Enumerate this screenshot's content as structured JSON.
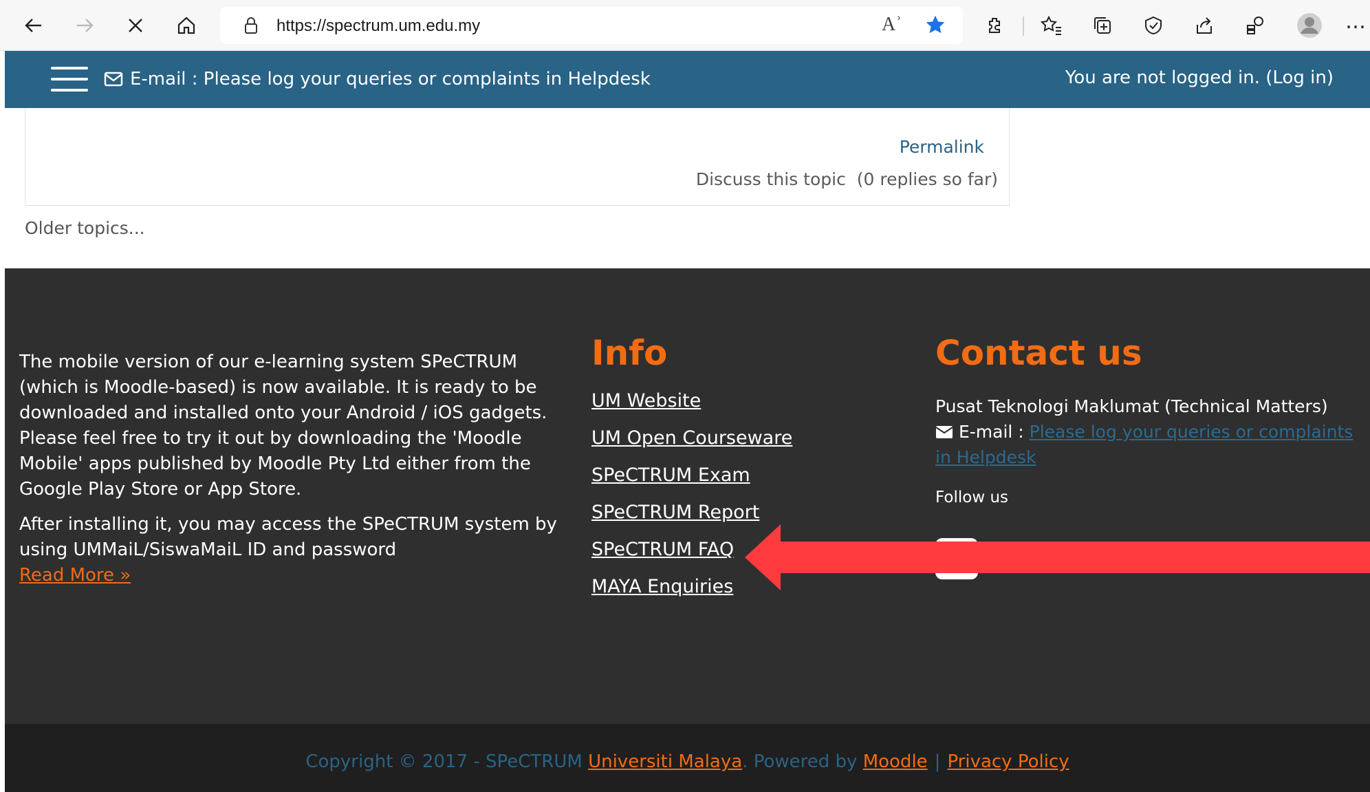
{
  "browser": {
    "url": "https://spectrum.um.edu.my",
    "icons": [
      "back-icon",
      "forward-icon",
      "stop-icon",
      "home-icon",
      "lock-icon",
      "read-aloud-icon",
      "favorite-star-icon",
      "extensions-icon",
      "favorites-icon",
      "collections-icon",
      "browser-essentials-icon",
      "share-icon",
      "performance-icon",
      "profile-icon",
      "more-icon"
    ],
    "read_aloud_glyph": "Aʾ",
    "more_glyph": "…"
  },
  "header": {
    "message": "E-mail : Please log your queries or complaints in Helpdesk",
    "login_status": "You are not logged in. (Log in)"
  },
  "post": {
    "permalink": "Permalink",
    "discuss": "Discuss this topic  (0 replies so far)"
  },
  "older_topics": "Older topics...",
  "footer": {
    "about_p1": "The mobile version of our e-learning system SPeCTRUM (which is Moodle-based) is now available. It is ready to be downloaded and installed onto your Android / iOS gadgets. Please feel free to try it out by downloading the 'Moodle Mobile' apps published by Moodle Pty Ltd either from the Google Play Store or App Store.",
    "about_p2": "After installing it, you may access the SPeCTRUM system by using UMMaiL/SiswaMaiL ID and password",
    "read_more": "Read More »",
    "info_title": "Info",
    "info_links": [
      "UM Website",
      "UM Open Courseware",
      "SPeCTRUM Exam",
      "SPeCTRUM Report",
      "SPeCTRUM FAQ",
      "MAYA Enquiries"
    ],
    "contact_title": "Contact us",
    "contact_org": "Pusat Teknologi Maklumat (Technical Matters)",
    "contact_email_label": "E-mail : ",
    "contact_email_link": "Please log your queries or complaints in Helpdesk",
    "follow_us": "Follow us"
  },
  "copyright": {
    "prefix": "Copyright © 2017 - SPeCTRUM ",
    "org_link": "Universiti Malaya",
    "powered": ". Powered by ",
    "moodle_link": "Moodle",
    "pipe": "|",
    "privacy_link": "Privacy Policy"
  },
  "colors": {
    "header_bg": "#296386",
    "footer_bg": "#2f2f2f",
    "accent_orange": "#f36c14",
    "arrow_red": "#ff3b3f"
  }
}
